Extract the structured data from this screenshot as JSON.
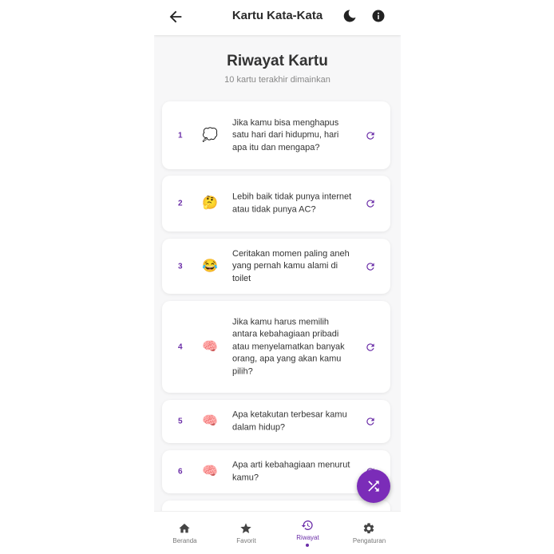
{
  "appbar": {
    "title": "Kartu Kata-Kata"
  },
  "page": {
    "heading": "Riwayat Kartu",
    "subheading": "10 kartu terakhir dimainkan"
  },
  "history": [
    {
      "number": "1",
      "emoji": "💭",
      "text": "Jika kamu bisa menghapus satu hari dari hidupmu, hari apa itu dan mengapa?"
    },
    {
      "number": "2",
      "emoji": "🤔",
      "text": "Lebih baik tidak punya internet atau tidak punya AC?"
    },
    {
      "number": "3",
      "emoji": "😂",
      "text": "Ceritakan momen paling aneh yang pernah kamu alami di toilet"
    },
    {
      "number": "4",
      "emoji": "🧠",
      "text": "Jika kamu harus memilih antara kebahagiaan pribadi atau menyelamatkan banyak orang, apa yang akan kamu pilih?"
    },
    {
      "number": "5",
      "emoji": "🧠",
      "text": "Apa ketakutan terbesar kamu dalam hidup?"
    },
    {
      "number": "6",
      "emoji": "🧠",
      "text": "Apa arti kebahagiaan menurut kamu?"
    }
  ],
  "nav": {
    "home": "Beranda",
    "favorites": "Favorit",
    "history": "Riwayat",
    "settings": "Pengaturan"
  },
  "colors": {
    "accent": "#7b2cb8",
    "accent_text": "#6b2ea8"
  },
  "icons": {
    "back": "arrow-left-icon",
    "theme": "moon-icon",
    "info": "info-icon",
    "replay": "replay-icon",
    "shuffle": "shuffle-icon",
    "home": "home-icon",
    "favorites": "star-icon",
    "history": "history-icon",
    "settings": "gear-icon"
  }
}
